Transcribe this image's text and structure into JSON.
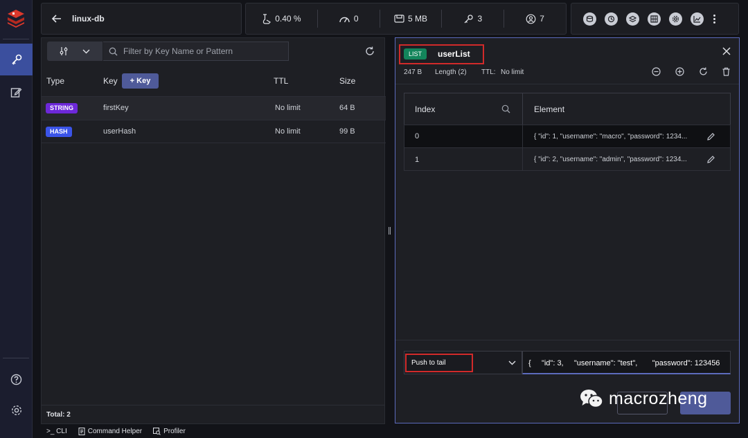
{
  "header": {
    "db_name": "linux-db",
    "stats": {
      "cpu": "0.40 %",
      "ops": "0",
      "memory": "5 MB",
      "keys": "3",
      "clients": "7"
    }
  },
  "browser": {
    "filter_placeholder": "Filter by Key Name or Pattern",
    "columns": {
      "type": "Type",
      "key": "Key",
      "ttl": "TTL",
      "size": "Size"
    },
    "add_key_label": "+ Key",
    "rows": [
      {
        "type": "STRING",
        "type_color": "#6d28d9",
        "key": "firstKey",
        "ttl": "No limit",
        "size": "64 B"
      },
      {
        "type": "HASH",
        "type_color": "#3b54e8",
        "key": "userHash",
        "ttl": "No limit",
        "size": "99 B"
      }
    ],
    "total": "Total: 2"
  },
  "details": {
    "type_badge": "LIST",
    "type_color": "#13855b",
    "key_name": "userList",
    "size": "247 B",
    "length": "Length (2)",
    "ttl_label": "TTL:",
    "ttl_value": "No limit",
    "columns": {
      "index": "Index",
      "element": "Element"
    },
    "items": [
      {
        "index": "0",
        "element": "{ \"id\": 1, \"username\": \"macro\", \"password\": 1234..."
      },
      {
        "index": "1",
        "element": "{ \"id\": 2, \"username\": \"admin\", \"password\": 1234..."
      }
    ],
    "push_select": "Push to tail",
    "push_value": "{     \"id\": 3,     \"username\": \"test\",       \"password\": 123456"
  },
  "footer": {
    "cli": ">_ CLI",
    "command_helper": "Command Helper",
    "profiler": "Profiler"
  },
  "watermark": "macrozheng"
}
